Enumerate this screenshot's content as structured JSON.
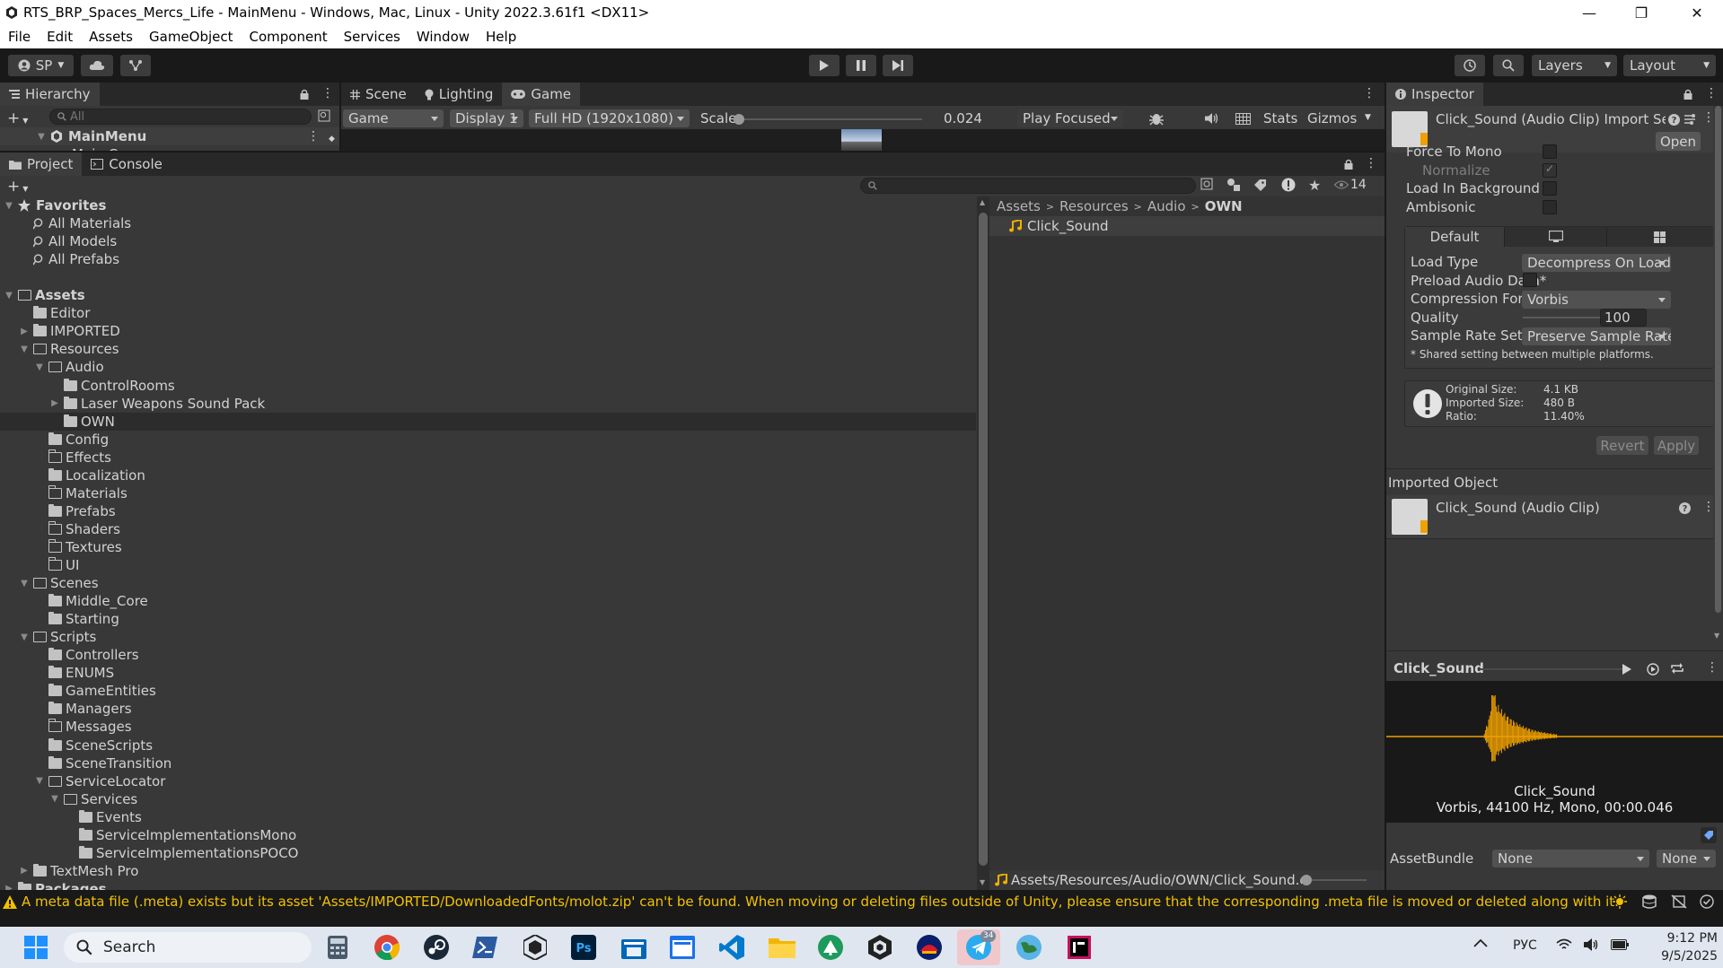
{
  "window": {
    "title": "RTS_BRP_Spaces_Mercs_Life - MainMenu - Windows, Mac, Linux - Unity 2022.3.61f1 <DX11>",
    "minimize": "—",
    "maximize": "❐",
    "close": "✕"
  },
  "menu": [
    "File",
    "Edit",
    "Assets",
    "GameObject",
    "Component",
    "Services",
    "Window",
    "Help"
  ],
  "toolbar": {
    "account": "SP",
    "layers": "Layers",
    "layout": "Layout"
  },
  "hierarchy": {
    "tab": "Hierarchy",
    "search_placeholder": "All",
    "scene": "MainMenu",
    "child_partial": "Main Camera"
  },
  "game_view": {
    "tabs": [
      "Scene",
      "Lighting",
      "Game"
    ],
    "mode": "Game",
    "display": "Display 1",
    "resolution": "Full HD (1920x1080)",
    "scale_label": "Scale",
    "scale_value": "0.024",
    "play_focused": "Play Focused",
    "stats": "Stats",
    "gizmos": "Gizmos"
  },
  "project": {
    "tabs": [
      "Project",
      "Console"
    ],
    "hidden_count": "14",
    "tree": [
      {
        "label": "Favorites",
        "level": 0,
        "type": "star",
        "expanded": true,
        "bold": true
      },
      {
        "label": "All Materials",
        "level": 1,
        "type": "search"
      },
      {
        "label": "All Models",
        "level": 1,
        "type": "search"
      },
      {
        "label": "All Prefabs",
        "level": 1,
        "type": "search"
      },
      {
        "label": "",
        "level": 0,
        "type": "spacer"
      },
      {
        "label": "Assets",
        "level": 0,
        "type": "open",
        "expanded": true,
        "bold": true
      },
      {
        "label": "Editor",
        "level": 1,
        "type": "filled"
      },
      {
        "label": "IMPORTED",
        "level": 1,
        "type": "filled",
        "expanded": false
      },
      {
        "label": "Resources",
        "level": 1,
        "type": "open",
        "expanded": true
      },
      {
        "label": "Audio",
        "level": 2,
        "type": "open",
        "expanded": true
      },
      {
        "label": "ControlRooms",
        "level": 3,
        "type": "filled"
      },
      {
        "label": "Laser Weapons Sound Pack",
        "level": 3,
        "type": "filled",
        "expanded": false
      },
      {
        "label": "OWN",
        "level": 3,
        "type": "filled",
        "selected": true
      },
      {
        "label": "Config",
        "level": 2,
        "type": "filled"
      },
      {
        "label": "Effects",
        "level": 2,
        "type": "empty"
      },
      {
        "label": "Localization",
        "level": 2,
        "type": "filled"
      },
      {
        "label": "Materials",
        "level": 2,
        "type": "empty"
      },
      {
        "label": "Prefabs",
        "level": 2,
        "type": "filled"
      },
      {
        "label": "Shaders",
        "level": 2,
        "type": "empty"
      },
      {
        "label": "Textures",
        "level": 2,
        "type": "empty"
      },
      {
        "label": "UI",
        "level": 2,
        "type": "empty"
      },
      {
        "label": "Scenes",
        "level": 1,
        "type": "open",
        "expanded": true
      },
      {
        "label": "Middle_Core",
        "level": 2,
        "type": "filled"
      },
      {
        "label": "Starting",
        "level": 2,
        "type": "filled"
      },
      {
        "label": "Scripts",
        "level": 1,
        "type": "open",
        "expanded": true
      },
      {
        "label": "Controllers",
        "level": 2,
        "type": "filled"
      },
      {
        "label": "ENUMS",
        "level": 2,
        "type": "filled"
      },
      {
        "label": "GameEntities",
        "level": 2,
        "type": "filled"
      },
      {
        "label": "Managers",
        "level": 2,
        "type": "filled"
      },
      {
        "label": "Messages",
        "level": 2,
        "type": "empty"
      },
      {
        "label": "SceneScripts",
        "level": 2,
        "type": "filled"
      },
      {
        "label": "SceneTransition",
        "level": 2,
        "type": "filled"
      },
      {
        "label": "ServiceLocator",
        "level": 2,
        "type": "open",
        "expanded": true
      },
      {
        "label": "Services",
        "level": 3,
        "type": "open",
        "expanded": true
      },
      {
        "label": "Events",
        "level": 4,
        "type": "filled"
      },
      {
        "label": "ServiceImplementationsMono",
        "level": 4,
        "type": "filled"
      },
      {
        "label": "ServiceImplementationsPOCO",
        "level": 4,
        "type": "filled"
      },
      {
        "label": "TextMesh Pro",
        "level": 1,
        "type": "filled",
        "expanded": false
      },
      {
        "label": "Packages",
        "level": 0,
        "type": "filled",
        "expanded": false,
        "bold": true
      }
    ],
    "breadcrumb": [
      "Assets",
      "Resources",
      "Audio",
      "OWN"
    ],
    "files": [
      "Click_Sound"
    ],
    "footer_path": "Assets/Resources/Audio/OWN/Click_Sound.ogg"
  },
  "inspector": {
    "tab": "Inspector",
    "title": "Click_Sound (Audio Clip) Import Settings",
    "open_btn": "Open",
    "force_to_mono": "Force To Mono",
    "normalize": "Normalize",
    "load_in_background": "Load In Background",
    "ambisonic": "Ambisonic",
    "platform_default": "Default",
    "load_type_label": "Load Type",
    "load_type": "Decompress On Load",
    "preload_label": "Preload Audio Data*",
    "compression_label": "Compression Format",
    "compression": "Vorbis",
    "quality_label": "Quality",
    "quality": "100",
    "quality_level": 1.0,
    "sample_rate_label": "Sample Rate Setting",
    "sample_rate": "Preserve Sample Rate",
    "shared_note": "* Shared setting between multiple platforms.",
    "info": [
      {
        "label": "Original Size:",
        "value": "4.1 KB"
      },
      {
        "label": "Imported Size:",
        "value": "480 B"
      },
      {
        "label": "Ratio:",
        "value": "11.40%"
      }
    ],
    "revert": "Revert",
    "apply": "Apply",
    "imported_object": "Imported Object",
    "imported_clip": "Click_Sound (Audio Clip)",
    "preview_name": "Click_Sound",
    "preview_title": "Click_Sound",
    "preview_info": "Vorbis, 44100 Hz, Mono, 00:00.046",
    "assetbundle_label": "AssetBundle",
    "assetbundle_value": "None",
    "assetbundle_variant": "None",
    "waveform_color": "#f0a000"
  },
  "status": {
    "message": "A meta data file (.meta) exists but its asset 'Assets/IMPORTED/DownloadedFonts/molot.zip' can't be found. When moving or deleting files outside of Unity, please ensure that the corresponding .meta file is moved or deleted along with it."
  },
  "taskbar": {
    "search": "Search",
    "lang": "РУС",
    "time": "9:12 PM",
    "date": "9/5/2025",
    "telegram_badge": "34",
    "apps": [
      "calculator-icon",
      "chrome-icon",
      "steam-icon",
      "powershell-icon",
      "unity-hub-icon",
      "photoshop-icon",
      "store-icon",
      "explorer-window-icon",
      "vscode-icon",
      "file-explorer-icon",
      "tree-app-icon",
      "unity-icon",
      "game-app-icon",
      "telegram-icon",
      "globe-app-icon",
      "rider-icon"
    ]
  }
}
